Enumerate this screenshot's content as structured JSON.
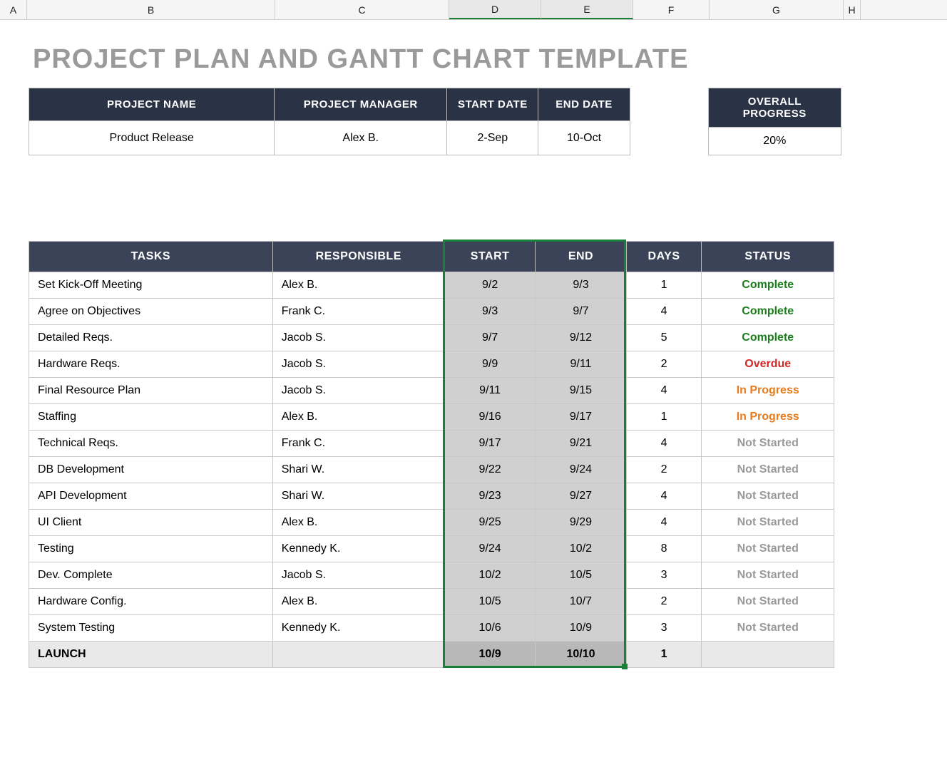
{
  "columns": [
    "A",
    "B",
    "C",
    "D",
    "E",
    "F",
    "G",
    "H"
  ],
  "selected_columns": [
    "D",
    "E"
  ],
  "title": "PROJECT PLAN AND GANTT CHART TEMPLATE",
  "summary": {
    "headers": {
      "project_name": "PROJECT NAME",
      "project_manager": "PROJECT MANAGER",
      "start_date": "START DATE",
      "end_date": "END DATE",
      "overall_progress": "OVERALL PROGRESS"
    },
    "values": {
      "project_name": "Product Release",
      "project_manager": "Alex B.",
      "start_date": "2-Sep",
      "end_date": "10-Oct",
      "overall_progress": "20%"
    }
  },
  "tasks_table": {
    "headers": {
      "tasks": "TASKS",
      "responsible": "RESPONSIBLE",
      "start": "START",
      "end": "END",
      "days": "DAYS",
      "status": "STATUS"
    },
    "status_labels": {
      "complete": "Complete",
      "overdue": "Overdue",
      "inprogress": "In Progress",
      "notstarted": "Not Started"
    },
    "rows": [
      {
        "task": "Set Kick-Off Meeting",
        "responsible": "Alex B.",
        "start": "9/2",
        "end": "9/3",
        "days": "1",
        "status": "complete"
      },
      {
        "task": "Agree on Objectives",
        "responsible": "Frank C.",
        "start": "9/3",
        "end": "9/7",
        "days": "4",
        "status": "complete"
      },
      {
        "task": "Detailed Reqs.",
        "responsible": "Jacob S.",
        "start": "9/7",
        "end": "9/12",
        "days": "5",
        "status": "complete"
      },
      {
        "task": "Hardware Reqs.",
        "responsible": "Jacob S.",
        "start": "9/9",
        "end": "9/11",
        "days": "2",
        "status": "overdue"
      },
      {
        "task": "Final Resource Plan",
        "responsible": "Jacob S.",
        "start": "9/11",
        "end": "9/15",
        "days": "4",
        "status": "inprogress"
      },
      {
        "task": "Staffing",
        "responsible": "Alex B.",
        "start": "9/16",
        "end": "9/17",
        "days": "1",
        "status": "inprogress"
      },
      {
        "task": "Technical Reqs.",
        "responsible": "Frank C.",
        "start": "9/17",
        "end": "9/21",
        "days": "4",
        "status": "notstarted"
      },
      {
        "task": "DB Development",
        "responsible": "Shari W.",
        "start": "9/22",
        "end": "9/24",
        "days": "2",
        "status": "notstarted"
      },
      {
        "task": "API Development",
        "responsible": "Shari W.",
        "start": "9/23",
        "end": "9/27",
        "days": "4",
        "status": "notstarted"
      },
      {
        "task": "UI Client",
        "responsible": "Alex B.",
        "start": "9/25",
        "end": "9/29",
        "days": "4",
        "status": "notstarted"
      },
      {
        "task": "Testing",
        "responsible": "Kennedy K.",
        "start": "9/24",
        "end": "10/2",
        "days": "8",
        "status": "notstarted"
      },
      {
        "task": "Dev. Complete",
        "responsible": "Jacob S.",
        "start": "10/2",
        "end": "10/5",
        "days": "3",
        "status": "notstarted"
      },
      {
        "task": "Hardware Config.",
        "responsible": "Alex B.",
        "start": "10/5",
        "end": "10/7",
        "days": "2",
        "status": "notstarted"
      },
      {
        "task": "System Testing",
        "responsible": "Kennedy K.",
        "start": "10/6",
        "end": "10/9",
        "days": "3",
        "status": "notstarted"
      }
    ],
    "launch_row": {
      "task": "LAUNCH",
      "responsible": "",
      "start": "10/9",
      "end": "10/10",
      "days": "1",
      "status": ""
    }
  }
}
